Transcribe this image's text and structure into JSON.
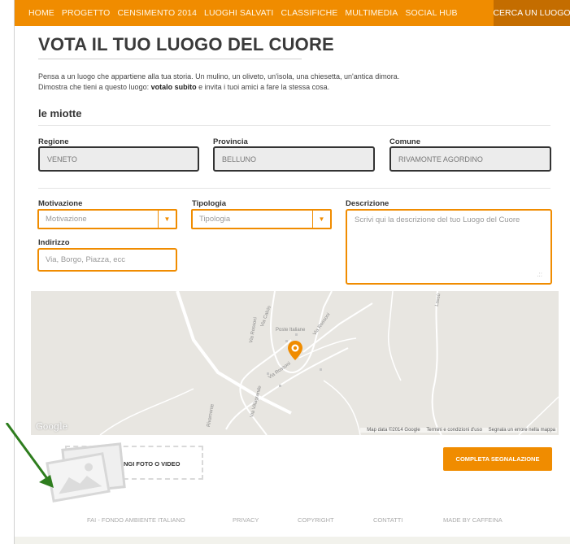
{
  "nav": {
    "items": [
      "HOME",
      "PROGETTO",
      "CENSIMENTO 2014",
      "LUOGHI SALVATI",
      "CLASSIFICHE",
      "MULTIMEDIA",
      "SOCIAL HUB"
    ],
    "cta": "CERCA UN LUOGO"
  },
  "page": {
    "title": "VOTA IL TUO LUOGO DEL CUORE",
    "intro_line1": "Pensa a un luogo che appartiene alla tua storia. Un mulino, un oliveto, un'isola, una chiesetta, un'antica dimora.",
    "intro_line2_pre": "Dimostra che tieni a questo luogo: ",
    "intro_line2_bold": "votalo subito",
    "intro_line2_post": " e invita i tuoi amici a fare la stessa cosa.",
    "section_title": "le miotte"
  },
  "location": {
    "regione_label": "Regione",
    "regione_value": "VENETO",
    "provincia_label": "Provincia",
    "provincia_value": "BELLUNO",
    "comune_label": "Comune",
    "comune_value": "RIVAMONTE AGORDINO"
  },
  "form": {
    "motivazione_label": "Motivazione",
    "motivazione_value": "Motivazione",
    "tipologia_label": "Tipologia",
    "tipologia_value": "Tipologia",
    "descrizione_label": "Descrizione",
    "descrizione_placeholder": "Scrivi qui la descrizione del tuo Luogo del Cuore",
    "indirizzo_label": "Indirizzo",
    "indirizzo_placeholder": "Via, Borgo, Piazza, ecc"
  },
  "map": {
    "logo": "Google",
    "labels": [
      "Poste Italiane",
      "Via Calcio",
      "Via Rossoni",
      "Via Rossoni",
      "Via Rossoni",
      "Via Villagrande",
      "Lassù",
      "Rivamonte"
    ],
    "attribution": [
      "Map data ©2014 Google",
      "Termini e condizioni d'uso",
      "Segnala un errore nella mappa"
    ]
  },
  "upload": {
    "label": "NGI FOTO O VIDEO"
  },
  "actions": {
    "complete": "COMPLETA SEGNALAZIONE"
  },
  "footer": {
    "links": [
      "FAI - FONDO AMBIENTE ITALIANO",
      "PRIVACY",
      "COPYRIGHT",
      "CONTATTI",
      "MADE BY CAFFEINA"
    ]
  },
  "colors": {
    "accent": "#f08c00",
    "accent_dark": "#c46d00",
    "arrow": "#2e7d1e"
  }
}
